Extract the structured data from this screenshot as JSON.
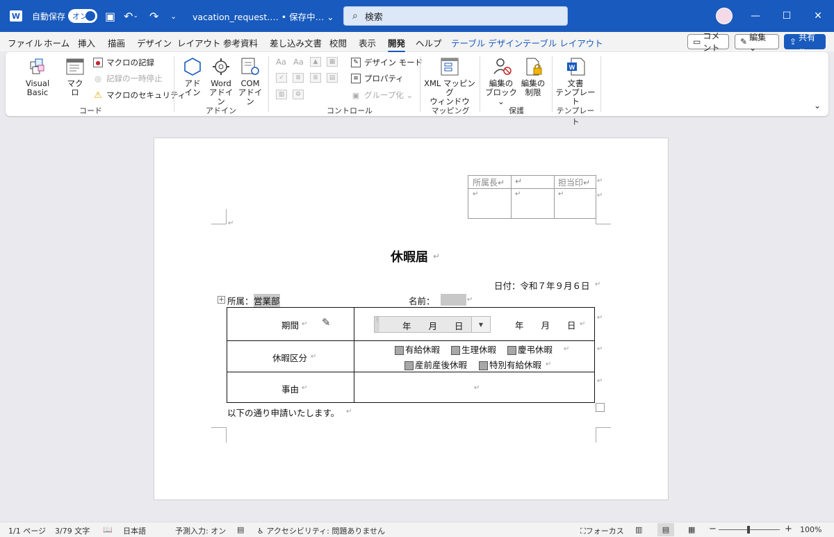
{
  "titlebar": {
    "app_icon": "W",
    "autosave_label": "自動保存",
    "autosave_state": "オン",
    "doc_title": "vacation_request.… • 保存中… ⌄",
    "search_placeholder": "検索"
  },
  "tabs": [
    "ファイル",
    "ホーム",
    "挿入",
    "描画",
    "デザイン",
    "レイアウト",
    "参考資料",
    "差し込み文書",
    "校閲",
    "表示",
    "開発",
    "ヘルプ",
    "テーブル デザイン",
    "テーブル レイアウト"
  ],
  "active_tab": "開発",
  "tab_buttons": {
    "comment": "コメント",
    "edit": "編集 ⌄",
    "share": "共有 ⌄"
  },
  "ribbon": {
    "code": {
      "group_label": "コード",
      "visual_basic": "Visual Basic",
      "macro": "マクロ",
      "record_macro": "マクロの記録",
      "pause_recording": "記録の一時停止",
      "macro_security": "マクロのセキュリティ"
    },
    "addins": {
      "group_label": "アドイン",
      "addin": [
        "アド",
        "イン"
      ],
      "word_addin": [
        "Word",
        "アドイン"
      ],
      "com_addin": [
        "COM",
        "アドイン"
      ]
    },
    "controls": {
      "group_label": "コントロール",
      "design_mode": "デザイン モード",
      "properties": "プロパティ",
      "group": "グループ化 ⌄",
      "row1": [
        "Aa",
        "Aa"
      ]
    },
    "mapping": {
      "group_label": "マッピング",
      "xml_mapping": [
        "XML マッピング",
        "ウィンドウ"
      ]
    },
    "protect": {
      "group_label": "保護",
      "block_authors": [
        "編集の",
        "ブロック ⌄"
      ],
      "restrict_editing": [
        "編集の",
        "制限"
      ]
    },
    "templates": {
      "group_label": "テンプレート",
      "doc_template": [
        "文書",
        "テンプレート"
      ]
    }
  },
  "document": {
    "stamp_headers": [
      "所属長↵",
      "↵",
      "担当印↵"
    ],
    "stamp_cells": [
      "↵",
      "↵",
      "↵"
    ],
    "title": "休暇届",
    "date_line": "日付：令和７年９月６日",
    "dept_label": "所属：",
    "dept_value": "営業部",
    "name_label": "名前：",
    "rows": [
      {
        "label": "期間"
      },
      {
        "label": "休暇区分"
      },
      {
        "label": "事由"
      }
    ],
    "period_from": "年　　月　　日",
    "period_to": "年　　月　　日",
    "leave_types_line1": [
      "有給休暇",
      "生理休暇",
      "慶弔休暇"
    ],
    "leave_types_line2": [
      "産前産後休暇",
      "特別有給休暇"
    ],
    "closing": "以下の通り申請いたします。",
    "para_mark": "↵"
  },
  "statusbar": {
    "page": "1/1 ページ",
    "words": "3/79 文字",
    "language": "日本語",
    "predict": "予測入力: オン",
    "accessibility": "アクセシビリティ: 問題ありません",
    "focus": "フォーカス",
    "zoom": "100%",
    "zoom_minus": "−",
    "zoom_plus": "+"
  }
}
